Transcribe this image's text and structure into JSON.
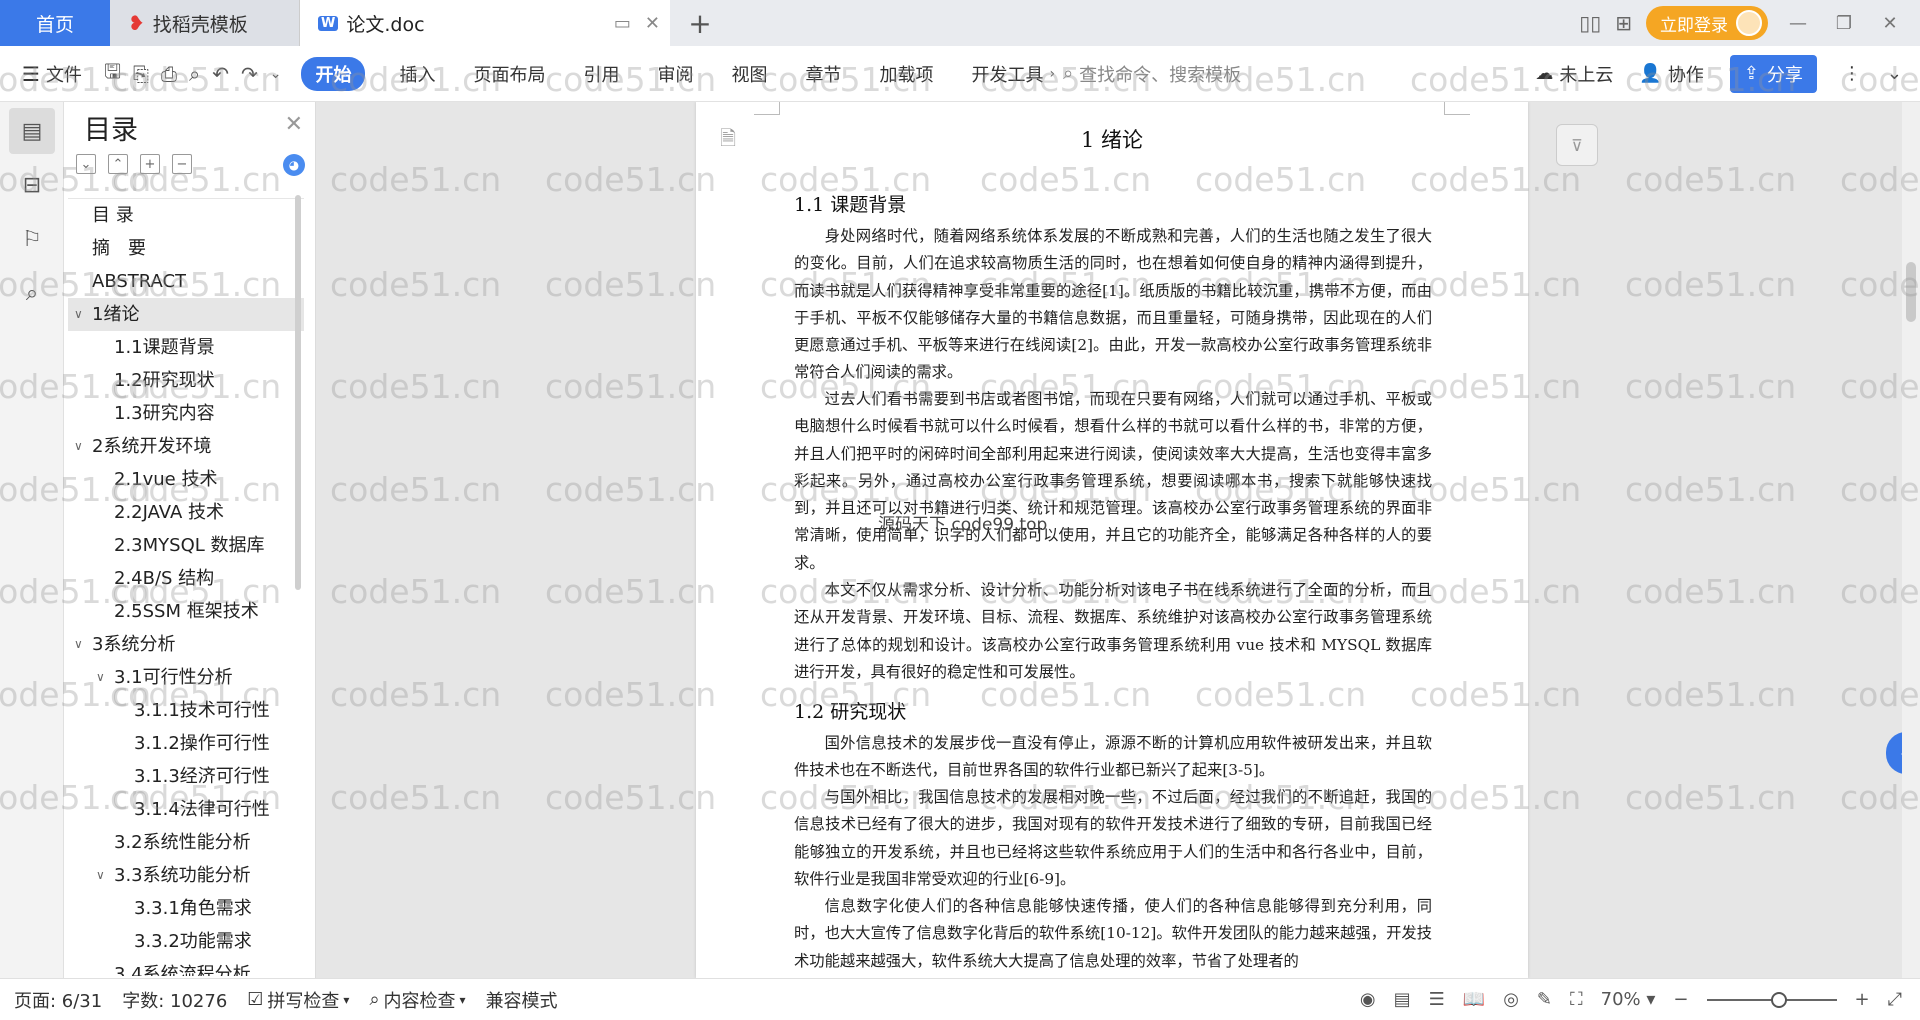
{
  "tabs": {
    "home": "首页",
    "templates": "找稻壳模板",
    "doc": "论文.doc"
  },
  "header": {
    "login": "立即登录"
  },
  "ribbon": {
    "file": "文件",
    "tabs": [
      "开始",
      "插入",
      "页面布局",
      "引用",
      "审阅",
      "视图",
      "章节",
      "加载项",
      "开发工具"
    ],
    "search_placeholder": "查找命令、搜索模板",
    "cloud": "未上云",
    "collab": "协作",
    "share": "分享"
  },
  "toc": {
    "title": "目录",
    "items": [
      {
        "label": "目 录",
        "level": 0
      },
      {
        "label": "摘　要",
        "level": 0
      },
      {
        "label": "ABSTRACT",
        "level": 0
      },
      {
        "label": "1绪论",
        "level": 0,
        "caret": true,
        "active": true
      },
      {
        "label": "1.1课题背景",
        "level": 1
      },
      {
        "label": "1.2研究现状",
        "level": 1
      },
      {
        "label": "1.3研究内容",
        "level": 1
      },
      {
        "label": "2系统开发环境",
        "level": 0,
        "caret": true
      },
      {
        "label": "2.1vue 技术",
        "level": 1
      },
      {
        "label": "2.2JAVA 技术",
        "level": 1
      },
      {
        "label": "2.3MYSQL 数据库",
        "level": 1
      },
      {
        "label": "2.4B/S 结构",
        "level": 1
      },
      {
        "label": "2.5SSM 框架技术",
        "level": 1
      },
      {
        "label": "3系统分析",
        "level": 0,
        "caret": true
      },
      {
        "label": "3.1可行性分析",
        "level": 1,
        "caret": true
      },
      {
        "label": "3.1.1技术可行性",
        "level": 2
      },
      {
        "label": "3.1.2操作可行性",
        "level": 2
      },
      {
        "label": "3.1.3经济可行性",
        "level": 2
      },
      {
        "label": "3.1.4法律可行性",
        "level": 2
      },
      {
        "label": "3.2系统性能分析",
        "level": 1
      },
      {
        "label": "3.3系统功能分析",
        "level": 1,
        "caret": true
      },
      {
        "label": "3.3.1角色需求",
        "level": 2
      },
      {
        "label": "3.3.2功能需求",
        "level": 2
      },
      {
        "label": "3.4系统流程分析",
        "level": 1
      }
    ]
  },
  "document": {
    "chapter_title": "1  绪论",
    "section1_title": "1.1  课题背景",
    "p1": "身处网络时代，随着网络系统体系发展的不断成熟和完善，人们的生活也随之发生了很大的变化。目前，人们在追求较高物质生活的同时，也在想着如何使自身的精神内涵得到提升，而读书就是人们获得精神享受非常重要的途径[1]。纸质版的书籍比较沉重，携带不方便，而由于手机、平板不仅能够储存大量的书籍信息数据，而且重量轻，可随身携带，因此现在的人们更愿意通过手机、平板等来进行在线阅读[2]。由此，开发一款高校办公室行政事务管理系统非常符合人们阅读的需求。",
    "p2": "过去人们看书需要到书店或者图书馆，而现在只要有网络，人们就可以通过手机、平板或电脑想什么时候看书就可以什么时候看，想看什么样的书就可以看什么样的书，非常的方便，并且人们把平时的闲碎时间全部利用起来进行阅读，使阅读效率大大提高，生活也变得丰富多彩起来。另外，通过高校办公室行政事务管理系统，想要阅读哪本书，搜索下就能够快速找到，并且还可以对书籍进行归类、统计和规范管理。该高校办公室行政事务管理系统的界面非常清晰，使用简单，识字的人们都可以使用，并且它的功能齐全，能够满足各种各样的人的要求。",
    "p3": "本文不仅从需求分析、设计分析、功能分析对该电子书在线系统进行了全面的分析，而且还从开发背景、开发环境、目标、流程、数据库、系统维护对该高校办公室行政事务管理系统进行了总体的规划和设计。该高校办公室行政事务管理系统利用 vue 技术和 MYSQL 数据库进行开发，具有很好的稳定性和可发展性。",
    "section2_title": "1.2  研究现状",
    "p4": "国外信息技术的发展步伐一直没有停止，源源不断的计算机应用软件被研发出来，并且软件技术也在不断迭代，目前世界各国的软件行业都已新兴了起来[3-5]。",
    "p5": "与国外相比，我国信息技术的发展相对晚一些，不过后面，经过我们的不断追赶，我国的信息技术已经有了很大的进步，我国对现有的软件开发技术进行了细致的专研，目前我国已经能够独立的开发系统，并且也已经将这些软件系统应用于人们的生活中和各行各业中，目前，软件行业是我国非常受欢迎的行业[6-9]。",
    "p6": "信息数字化使人们的各种信息能够快速传播，使人们的各种信息能够得到充分利用，同时，也大大宣传了信息数字化背后的软件系统[10-12]。软件开发团队的能力越来越强，开发技术功能越来越强大，软件系统大大提高了信息处理的效率，节省了处理者的",
    "overlay_text": "源码天下 code99.top"
  },
  "status": {
    "page": "页面: 6/31",
    "words": "字数: 10276",
    "spell": "拼写检查",
    "content": "内容检查",
    "compat": "兼容模式",
    "zoom": "70%"
  },
  "watermark": "code51.cn"
}
